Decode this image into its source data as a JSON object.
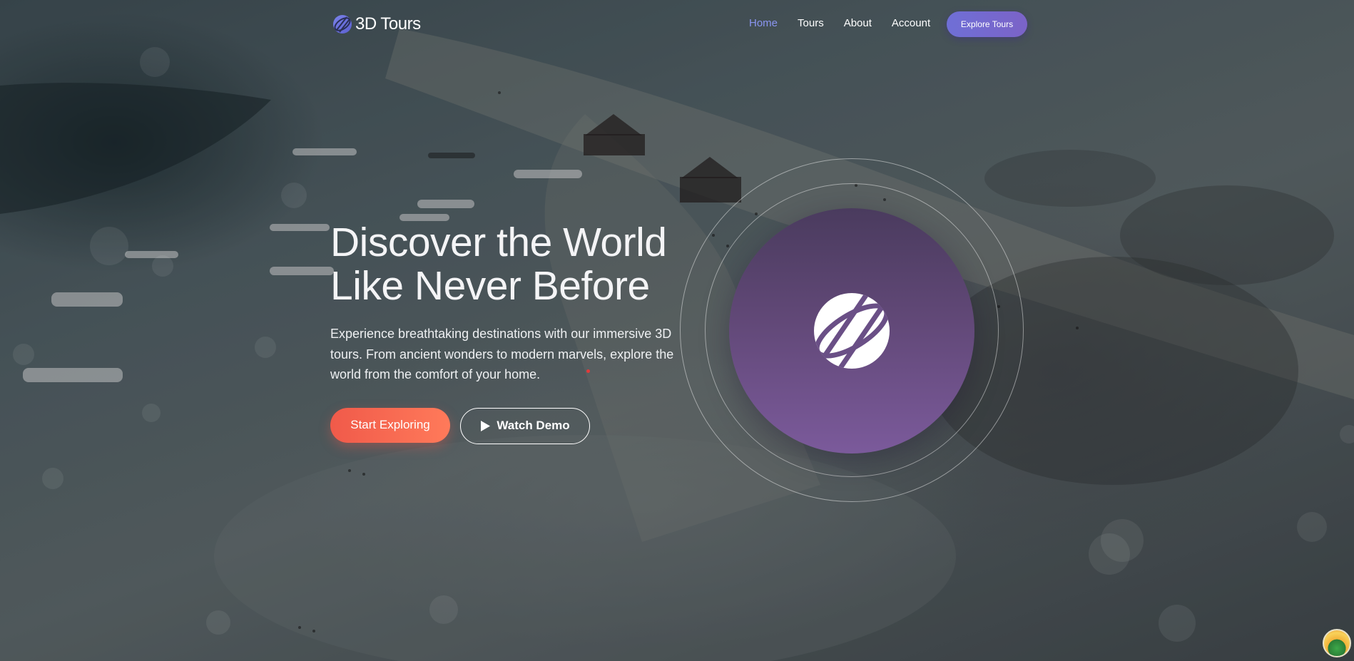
{
  "header": {
    "logo_text": "3D Tours",
    "logo_icon": "globe-icon",
    "nav": [
      {
        "label": "Home",
        "active": true
      },
      {
        "label": "Tours",
        "active": false
      },
      {
        "label": "About",
        "active": false
      },
      {
        "label": "Account",
        "active": false
      }
    ],
    "cta_label": "Explore Tours"
  },
  "hero": {
    "headline_line1": "Discover the World",
    "headline_line2": "Like Never Before",
    "description": "Experience breathtaking destinations with our immersive 3D tours. From ancient wonders to modern marvels, explore the world from the comfort of your home.",
    "primary_button": "Start Exploring",
    "secondary_button": "Watch Demo",
    "secondary_icon": "play-icon",
    "visual_icon": "globe-icon"
  },
  "colors": {
    "accent_nav": "#8a95f0",
    "cta_gradient_start": "#6f6fd6",
    "primary_button": "#f05a4a",
    "globe_circle": "#614877"
  }
}
